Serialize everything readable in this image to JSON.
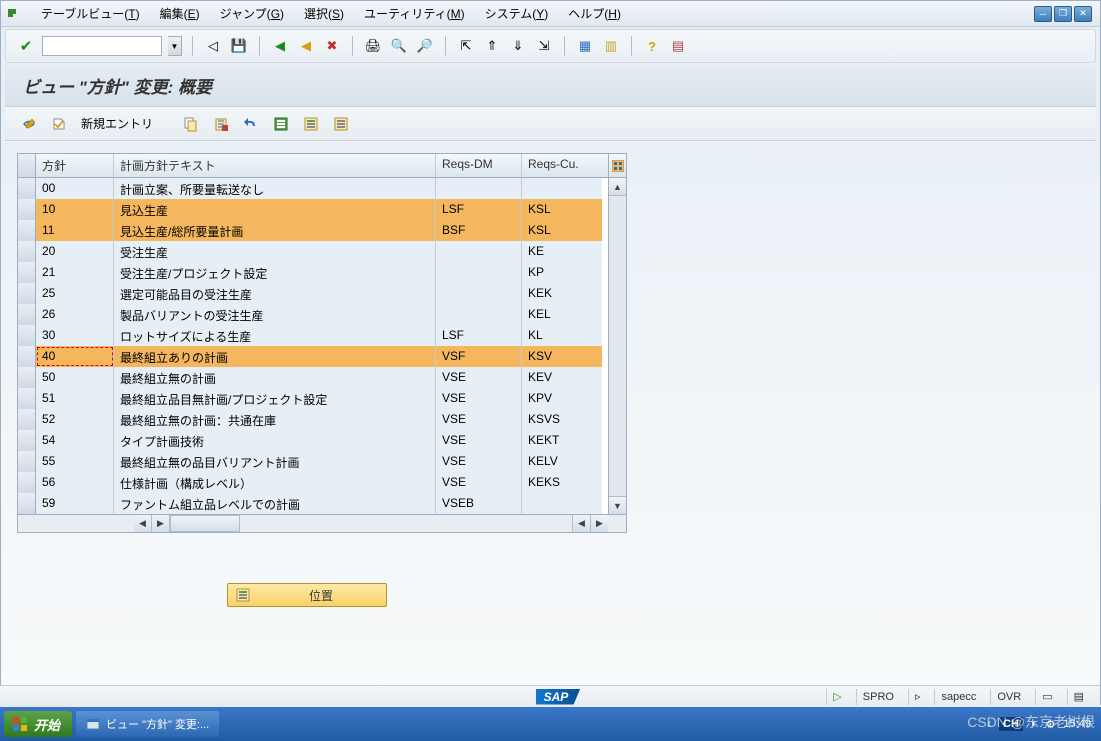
{
  "menu": {
    "items": [
      {
        "label": "テーブルビュー",
        "key": "T"
      },
      {
        "label": "編集",
        "key": "E"
      },
      {
        "label": "ジャンプ",
        "key": "G"
      },
      {
        "label": "選択",
        "key": "S"
      },
      {
        "label": "ユーティリティ",
        "key": "M"
      },
      {
        "label": "システム",
        "key": "Y"
      },
      {
        "label": "ヘルプ",
        "key": "H"
      }
    ]
  },
  "title": "ビュー \"方針\" 変更: 概要",
  "app_toolbar": {
    "new_entry": "新規エントリ"
  },
  "table": {
    "headers": {
      "col_a": "方針",
      "col_b": "計画方針テキスト",
      "col_c": "Reqs-DM",
      "col_d": "Reqs-Cu."
    },
    "rows": [
      {
        "a": "00",
        "b": "計画立案、所要量転送なし",
        "c": "",
        "d": "",
        "hl": false,
        "cur": false
      },
      {
        "a": "10",
        "b": "見込生産",
        "c": "LSF",
        "d": "KSL",
        "hl": true,
        "cur": false
      },
      {
        "a": "11",
        "b": "見込生産/総所要量計画",
        "c": "BSF",
        "d": "KSL",
        "hl": true,
        "cur": false
      },
      {
        "a": "20",
        "b": "受注生産",
        "c": "",
        "d": "KE",
        "hl": false,
        "cur": false
      },
      {
        "a": "21",
        "b": "受注生産/プロジェクト設定",
        "c": "",
        "d": "KP",
        "hl": false,
        "cur": false
      },
      {
        "a": "25",
        "b": "選定可能品目の受注生産",
        "c": "",
        "d": "KEK",
        "hl": false,
        "cur": false
      },
      {
        "a": "26",
        "b": "製品バリアントの受注生産",
        "c": "",
        "d": "KEL",
        "hl": false,
        "cur": false
      },
      {
        "a": "30",
        "b": "ロットサイズによる生産",
        "c": "LSF",
        "d": "KL",
        "hl": false,
        "cur": false
      },
      {
        "a": "40",
        "b": "最終組立ありの計画",
        "c": "VSF",
        "d": "KSV",
        "hl": true,
        "cur": true
      },
      {
        "a": "50",
        "b": "最終組立無の計画",
        "c": "VSE",
        "d": "KEV",
        "hl": false,
        "cur": false
      },
      {
        "a": "51",
        "b": "最終組立品目無計画/プロジェクト設定",
        "c": "VSE",
        "d": "KPV",
        "hl": false,
        "cur": false
      },
      {
        "a": "52",
        "b": "最終組立無の計画：共通在庫",
        "c": "VSE",
        "d": "KSVS",
        "hl": false,
        "cur": false
      },
      {
        "a": "54",
        "b": "タイプ計画技術",
        "c": "VSE",
        "d": "KEKT",
        "hl": false,
        "cur": false
      },
      {
        "a": "55",
        "b": "最終組立無の品目バリアント計画",
        "c": "VSE",
        "d": "KELV",
        "hl": false,
        "cur": false
      },
      {
        "a": "56",
        "b": "仕様計画（構成レベル）",
        "c": "VSE",
        "d": "KEKS",
        "hl": false,
        "cur": false
      },
      {
        "a": "59",
        "b": "ファントム組立品レベルでの計画",
        "c": "VSEB",
        "d": "",
        "hl": false,
        "cur": false
      }
    ]
  },
  "position_btn": "位置",
  "status": {
    "logo": "SAP",
    "tcode": "SPRO",
    "system": "sapecc",
    "mode": "OVR"
  },
  "taskbar": {
    "start": "开始",
    "task": "ビュー \"方針\" 変更:...",
    "lang": "CH",
    "time": "15:49"
  },
  "watermark": "CSDN @东京老树根"
}
